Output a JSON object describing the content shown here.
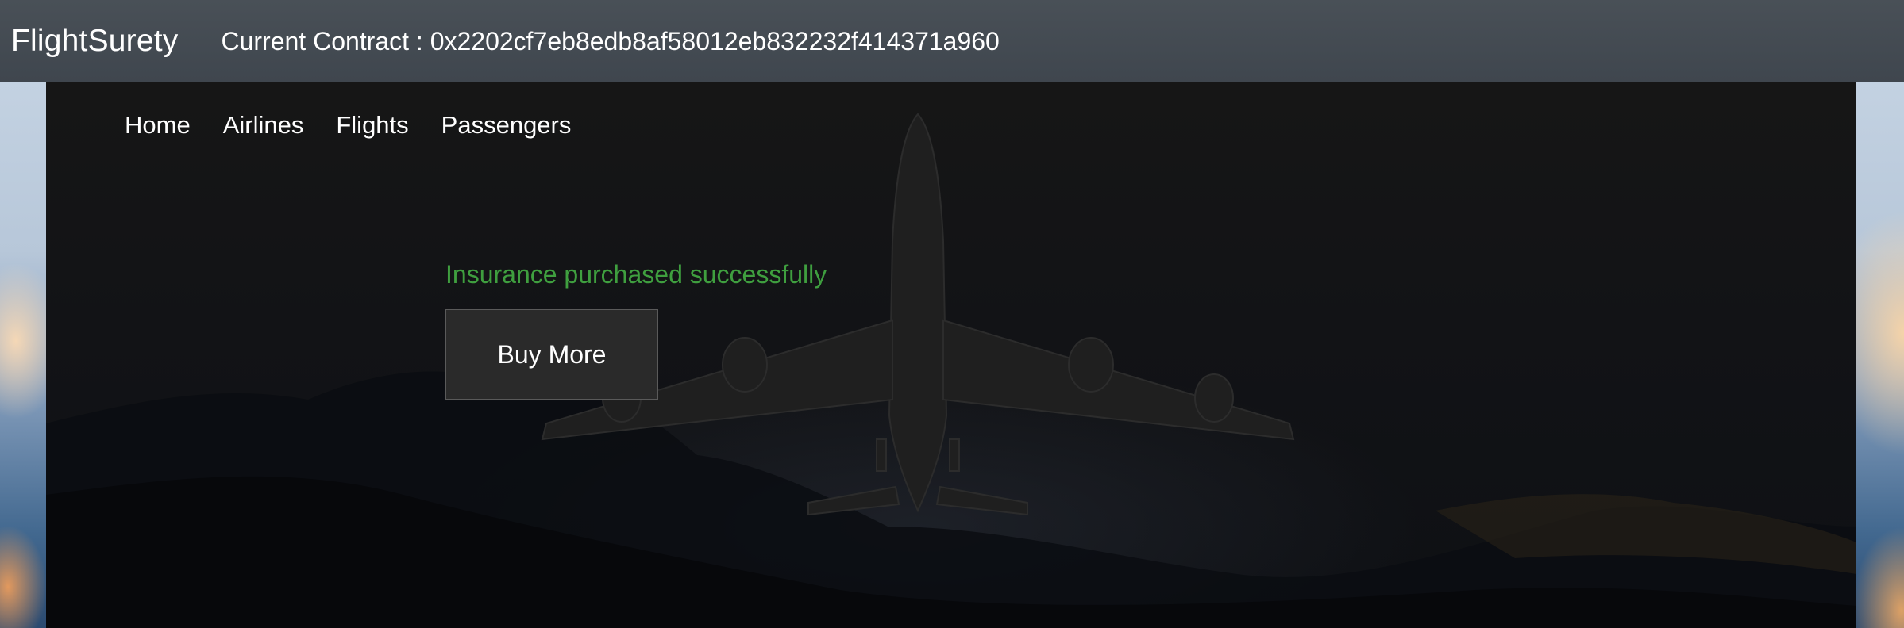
{
  "navbar": {
    "brand": "FlightSurety",
    "contract_label": "Current Contract : 0x2202cf7eb8edb8af58012eb832232f414371a960"
  },
  "subnav": {
    "items": [
      {
        "label": "Home"
      },
      {
        "label": "Airlines"
      },
      {
        "label": "Flights"
      },
      {
        "label": "Passengers"
      }
    ]
  },
  "main": {
    "status_message": "Insurance purchased successfully",
    "buy_more_label": "Buy More"
  },
  "colors": {
    "navbar_bg": "#495057",
    "panel_bg": "#151515",
    "success": "#3f9f3f"
  }
}
